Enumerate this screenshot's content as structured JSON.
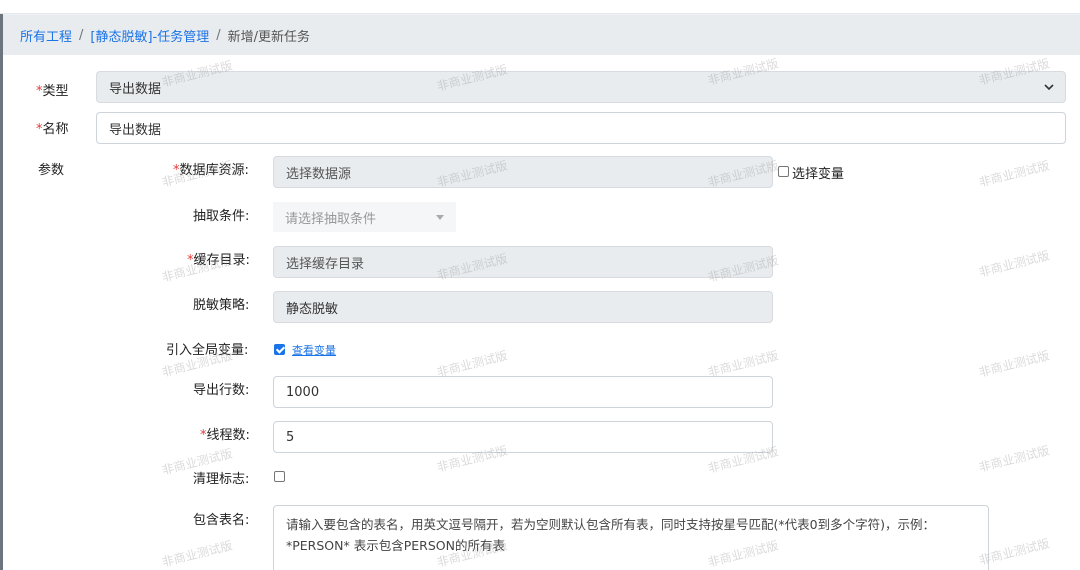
{
  "breadcrumb": {
    "all_projects": "所有工程",
    "task_mgmt": "[静态脱敏]-任务管理",
    "separator": "/",
    "current": "新增/更新任务"
  },
  "form": {
    "type": {
      "label": "类型",
      "value": "导出数据"
    },
    "name": {
      "label": "名称",
      "value": "导出数据"
    },
    "params_label": "参数",
    "db_resource": {
      "label": "数据库资源",
      "placeholder": "选择数据源",
      "var_label": "选择变量",
      "var_checked": false
    },
    "extract_condition": {
      "label": "抽取条件",
      "placeholder": "请选择抽取条件"
    },
    "cache_dir": {
      "label": "缓存目录",
      "placeholder": "选择缓存目录"
    },
    "strategy": {
      "label": "脱敏策略",
      "value": "静态脱敏"
    },
    "global_var": {
      "label": "引入全局变量",
      "checked": true,
      "link": "查看变量"
    },
    "export_rows": {
      "label": "导出行数",
      "value": "1000"
    },
    "threads": {
      "label": "线程数",
      "value": "5"
    },
    "clean_flag": {
      "label": "清理标志",
      "checked": false
    },
    "include_tables": {
      "label": "包含表名",
      "placeholder": "请输入要包含的表名，用英文逗号隔开，若为空则默认包含所有表，同时支持按星号匹配(*代表0到多个字符)，示例：*PERSON* 表示包含PERSON的所有表"
    }
  },
  "watermark": "非商业测试版",
  "colors": {
    "link": "#1a73e8",
    "required": "#e53935",
    "readonly_bg": "#e9ecef"
  }
}
